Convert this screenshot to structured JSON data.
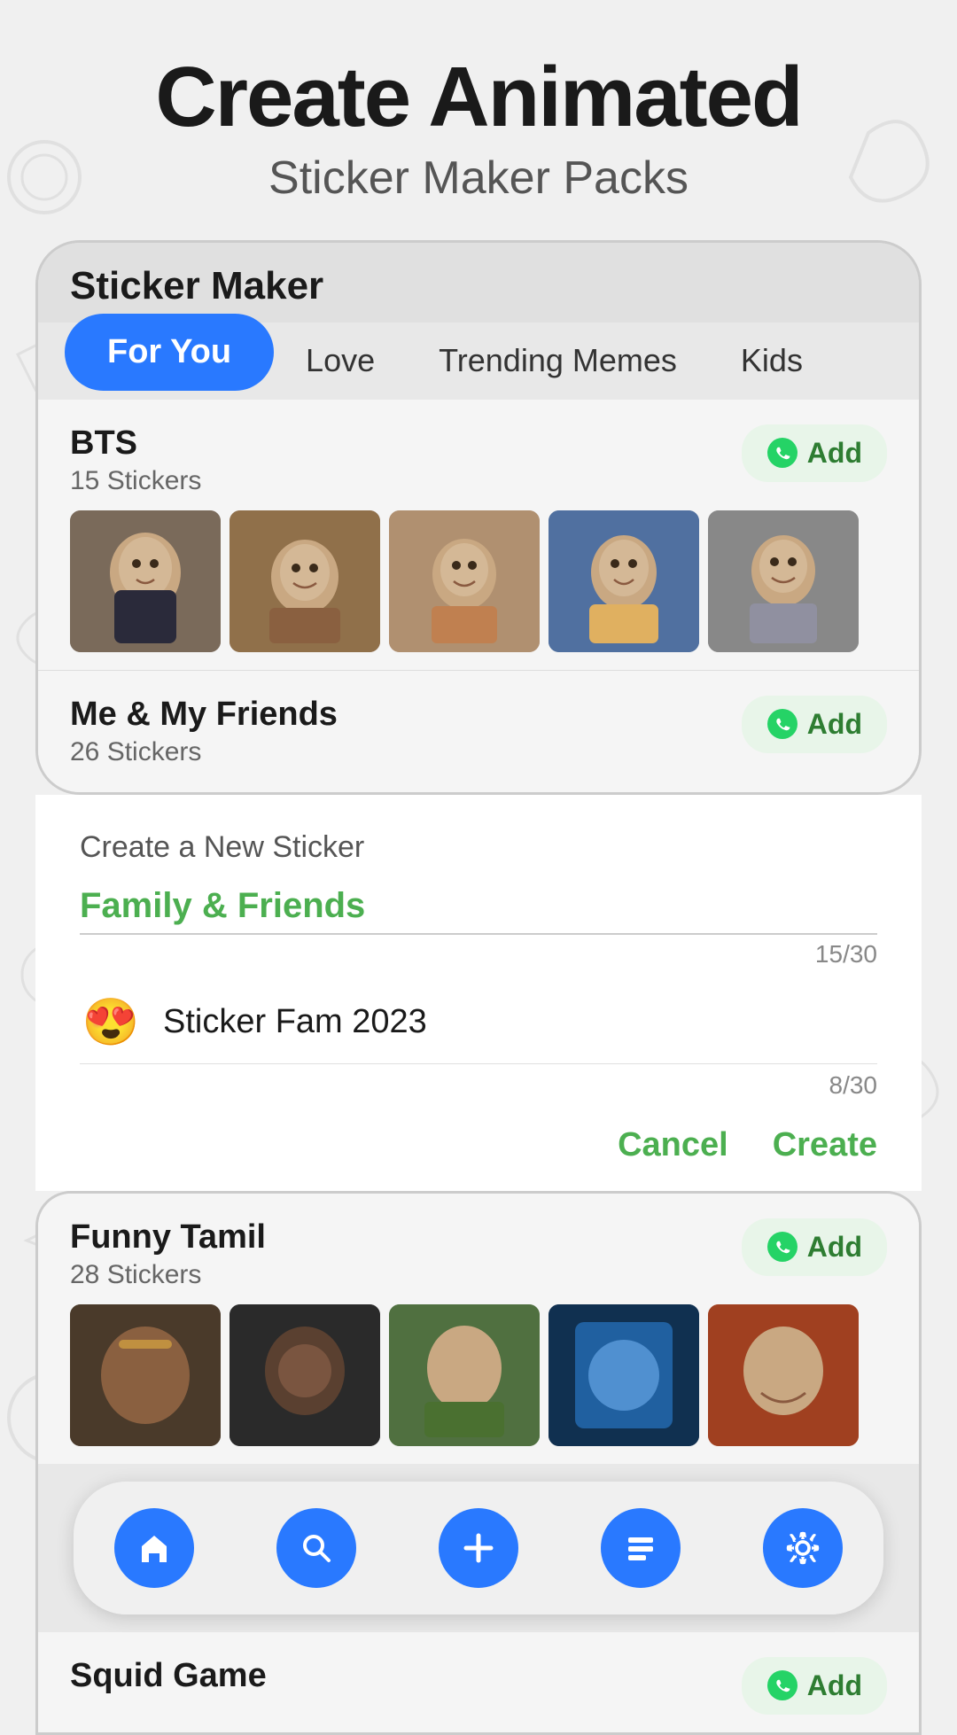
{
  "header": {
    "title_line1": "Create Animated",
    "title_line2": "Sticker Maker Packs"
  },
  "app": {
    "title": "Sticker Maker"
  },
  "tabs": [
    {
      "label": "For You",
      "active": true
    },
    {
      "label": "Love",
      "active": false
    },
    {
      "label": "Trending Memes",
      "active": false
    },
    {
      "label": "Kids",
      "active": false
    }
  ],
  "packs": [
    {
      "name": "BTS",
      "count": "15 Stickers",
      "add_label": "Add"
    },
    {
      "name": "Me & My Friends",
      "count": "26 Stickers",
      "add_label": "Add"
    },
    {
      "name": "Funny Tamil",
      "count": "28 Stickers",
      "add_label": "Add"
    },
    {
      "name": "Squid Game",
      "count": "",
      "add_label": "Add"
    }
  ],
  "modal": {
    "create_label": "Create a New Sticker",
    "field1_value": "Family & Friends",
    "field1_char_count": "15/30",
    "pack_emoji": "😍",
    "field2_value": "Sticker Fam 2023",
    "field2_char_count": "8/30",
    "cancel_label": "Cancel",
    "create_label_btn": "Create"
  },
  "bottom_nav": {
    "home": "home",
    "search": "search",
    "add": "add",
    "collection": "collection",
    "settings": "settings"
  }
}
